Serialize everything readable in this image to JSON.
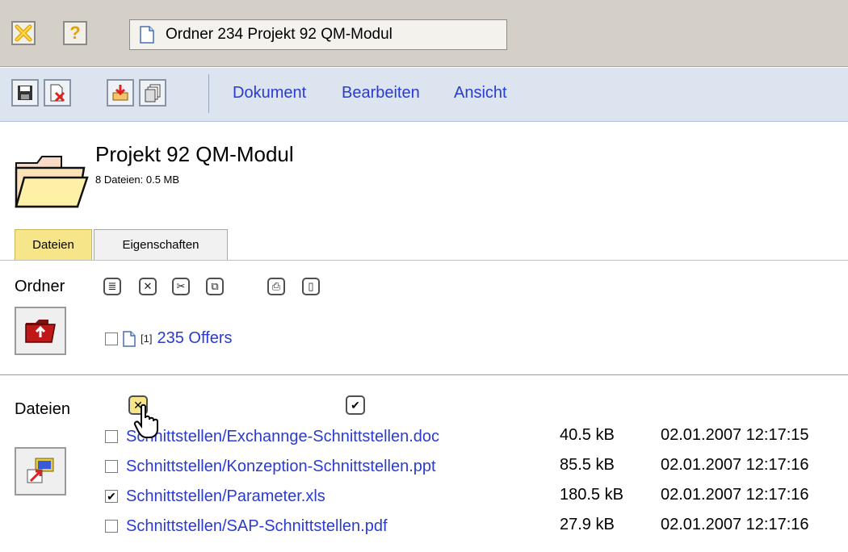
{
  "window": {
    "doc_tab_title": "Ordner 234 Projekt 92 QM-Modul"
  },
  "toolbar": {
    "icons": [
      "save-icon",
      "delete-document-icon",
      "download-icon",
      "copy-icon"
    ],
    "menu": [
      "Dokument",
      "Bearbeiten",
      "Ansicht"
    ]
  },
  "folder": {
    "title": "Projekt 92 QM-Modul",
    "info": "8 Dateien: 0.5 MB"
  },
  "tabs": [
    "Dateien",
    "Eigenschaften"
  ],
  "ordner": {
    "label": "Ordner",
    "actions": [
      "≣",
      "✕",
      "✂",
      "⧉",
      "⎙",
      "▯"
    ],
    "subfolder": {
      "count": "[1]",
      "name": "235 Offers",
      "checked": false
    }
  },
  "dateien": {
    "label": "Dateien",
    "files": [
      {
        "name": "Schnittstellen/Exchannge-Schnittstellen.doc",
        "size": "40.5 kB",
        "date": "02.01.2007 12:17:15",
        "checked": false
      },
      {
        "name": "Schnittstellen/Konzeption-Schnittstellen.ppt",
        "size": "85.5 kB",
        "date": "02.01.2007 12:17:16",
        "checked": false
      },
      {
        "name": "Schnittstellen/Parameter.xls",
        "size": "180.5 kB",
        "date": "02.01.2007 12:17:16",
        "checked": true
      },
      {
        "name": "Schnittstellen/SAP-Schnittstellen.pdf",
        "size": "27.9 kB",
        "date": "02.01.2007 12:17:16",
        "checked": false
      }
    ]
  }
}
